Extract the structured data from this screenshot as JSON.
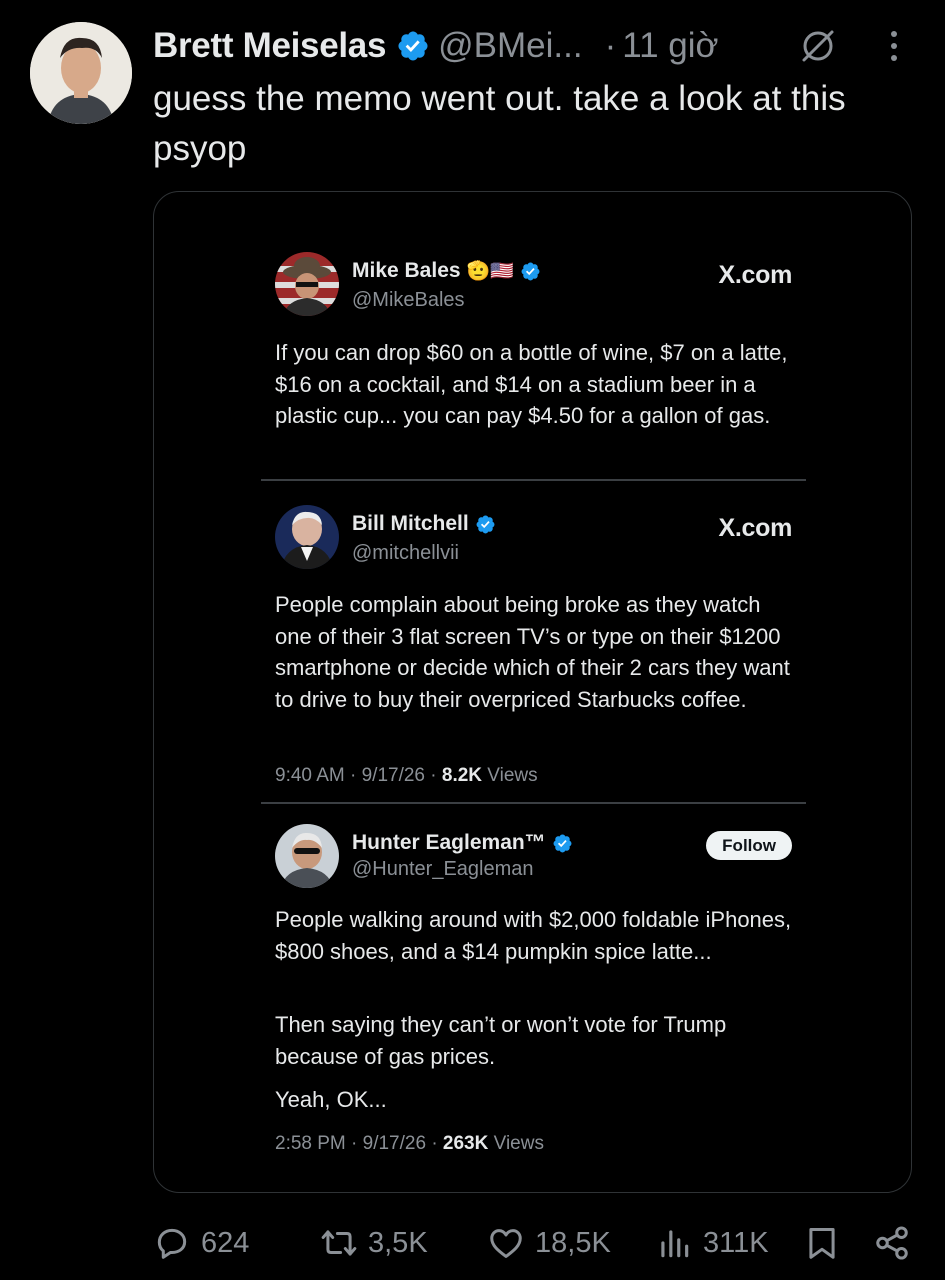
{
  "post": {
    "author_name": "Brett Meiselas",
    "handle": "@BMei...",
    "dot": "·",
    "time": "11 giờ",
    "text": "guess the memo went out. take a look at this psyop"
  },
  "embedded": [
    {
      "name": "Mike Bales",
      "emoji": "🫡🇺🇸",
      "handle": "@MikeBales",
      "right_label": "X.com",
      "body": "If you can drop $60 on a bottle of wine, $7 on a latte, $16 on a cocktail, and $14 on a stadium beer in a plastic cup... you can pay $4.50 for a gallon of gas."
    },
    {
      "name": "Bill Mitchell",
      "handle": "@mitchellvii",
      "right_label": "X.com",
      "body": "People complain about being broke as they watch one of their 3 flat screen TV’s or type on their $1200 smartphone or decide which of their 2 cars they want to drive to buy their overpriced Starbucks coffee.",
      "meta_time": "9:40 AM · 9/17/26 · ",
      "meta_views_count": "8.2K",
      "meta_views_label": " Views"
    },
    {
      "name": "Hunter Eagleman™",
      "handle": "@Hunter_Eagleman",
      "follow_label": "Follow",
      "body_p1": "People walking around with $2,000 foldable iPhones, $800 shoes, and a $14 pumpkin spice latte...",
      "body_p2": "Then saying they can’t or won’t vote for Trump because of gas prices.",
      "body_p3": "Yeah, OK...",
      "meta_time": "2:58 PM · 9/17/26 · ",
      "meta_views_count": "263K",
      "meta_views_label": " Views"
    }
  ],
  "actions": {
    "replies": "624",
    "reposts": "3,5K",
    "likes": "18,5K",
    "views": "311K"
  },
  "colors": {
    "background": "#000000",
    "text": "#e7e9ea",
    "muted": "#8b9096",
    "verified": "#1d9bf0"
  },
  "icons": [
    "verified-badge-icon",
    "grok-icon",
    "more-icon",
    "reply-icon",
    "repost-icon",
    "like-icon",
    "views-icon",
    "bookmark-icon",
    "share-icon"
  ]
}
